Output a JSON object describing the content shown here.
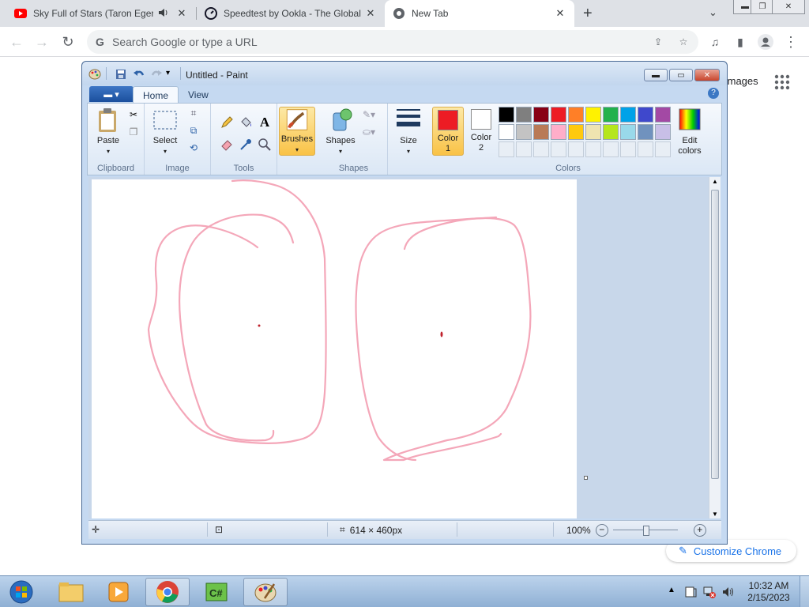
{
  "browser": {
    "tabs": [
      {
        "title": "Sky Full of Stars (Taron Egerto",
        "favicon": "youtube-icon",
        "audio": true,
        "active": false
      },
      {
        "title": "Speedtest by Ookla - The Global",
        "favicon": "speedtest-icon",
        "active": false
      },
      {
        "title": "New Tab",
        "favicon": "chrome-icon",
        "active": true
      }
    ],
    "omnibox_placeholder": "Search Google or type a URL",
    "ntp_images_label": "Images",
    "customize_label": "Customize Chrome"
  },
  "paint": {
    "title": "Untitled - Paint",
    "tabs": [
      "Home",
      "View"
    ],
    "groups": {
      "clipboard": {
        "label": "Clipboard",
        "paste": "Paste"
      },
      "image": {
        "label": "Image",
        "select": "Select"
      },
      "tools": {
        "label": "Tools"
      },
      "brushes": {
        "label": "Brushes"
      },
      "shapes": {
        "label": "Shapes",
        "shapes_btn": "Shapes"
      },
      "size": {
        "label": "Size"
      },
      "colors": {
        "label": "Colors",
        "color1_line1": "Color",
        "color1_line2": "1",
        "color2_line1": "Color",
        "color2_line2": "2",
        "edit_line1": "Edit",
        "edit_line2": "colors",
        "color1": "#ed1c24",
        "color2": "#ffffff",
        "palette_row1": [
          "#000000",
          "#7f7f7f",
          "#880015",
          "#ed1c24",
          "#ff7f27",
          "#fff200",
          "#22b14c",
          "#00a2e8",
          "#3f48cc",
          "#a349a4"
        ],
        "palette_row2": [
          "#ffffff",
          "#c3c3c3",
          "#b97a57",
          "#ffaec9",
          "#ffc90e",
          "#efe4b0",
          "#b5e61d",
          "#99d9ea",
          "#7092be",
          "#c8bfe7"
        ]
      }
    },
    "status": {
      "canvas_size": "614 × 460px",
      "zoom": "100%"
    },
    "stroke_color": "#f4a7b9"
  },
  "taskbar": {
    "time": "10:32 AM",
    "date": "2/15/2023"
  }
}
